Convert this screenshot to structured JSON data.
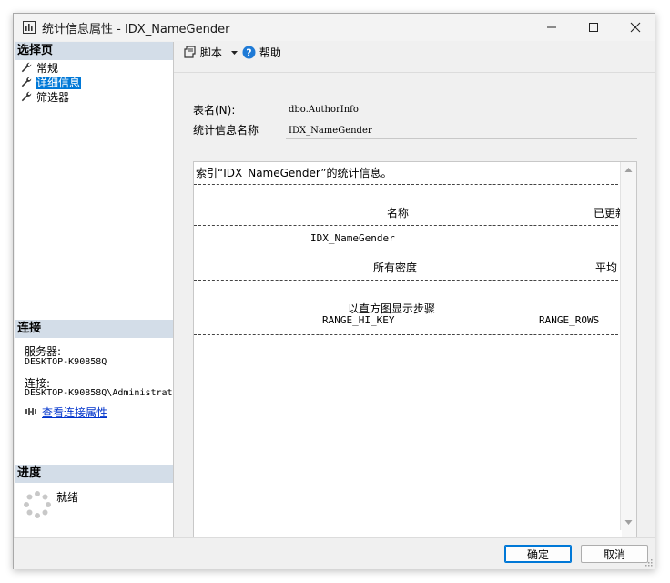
{
  "window": {
    "title": "统计信息属性 - IDX_NameGender"
  },
  "left_pane": {
    "select_page_header": "选择页",
    "nav_items": [
      {
        "label": "常规",
        "icon": "wrench-icon",
        "selected": false
      },
      {
        "label": "详细信息",
        "icon": "wrench-icon",
        "selected": true
      },
      {
        "label": "筛选器",
        "icon": "wrench-icon",
        "selected": false
      }
    ],
    "connection": {
      "header": "连接",
      "server_label": "服务器:",
      "server_value": "DESKTOP-K90858Q",
      "connection_label": "连接:",
      "connection_value": "DESKTOP-K90858Q\\Administrat",
      "view_link": "查看连接属性"
    },
    "progress": {
      "header": "进度",
      "status": "就绪"
    }
  },
  "toolbar": {
    "script_label": "脚本",
    "help_label": "帮助"
  },
  "details": {
    "table_name_label": "表名(N):",
    "table_name_value": "dbo.AuthorInfo",
    "stats_name_label": "统计信息名称",
    "stats_name_value": "IDX_NameGender",
    "text": {
      "line1": "索引“IDX_NameGender”的统计信息。",
      "col_name": "名称",
      "col_updated": "已更新",
      "row_name": "IDX_NameGender",
      "all_density": "所有密度",
      "avg": "平均",
      "histogram": "以直方图显示步骤",
      "range_hi_key": "RANGE_HI_KEY",
      "range_rows": "RANGE_ROWS"
    }
  },
  "footer": {
    "ok_label": "确定",
    "cancel_label": "取消"
  },
  "colors": {
    "selected": "#0078d7",
    "section_header": "#d3dde8",
    "link": "#0033cc",
    "help_icon": "#1e7ad6"
  }
}
